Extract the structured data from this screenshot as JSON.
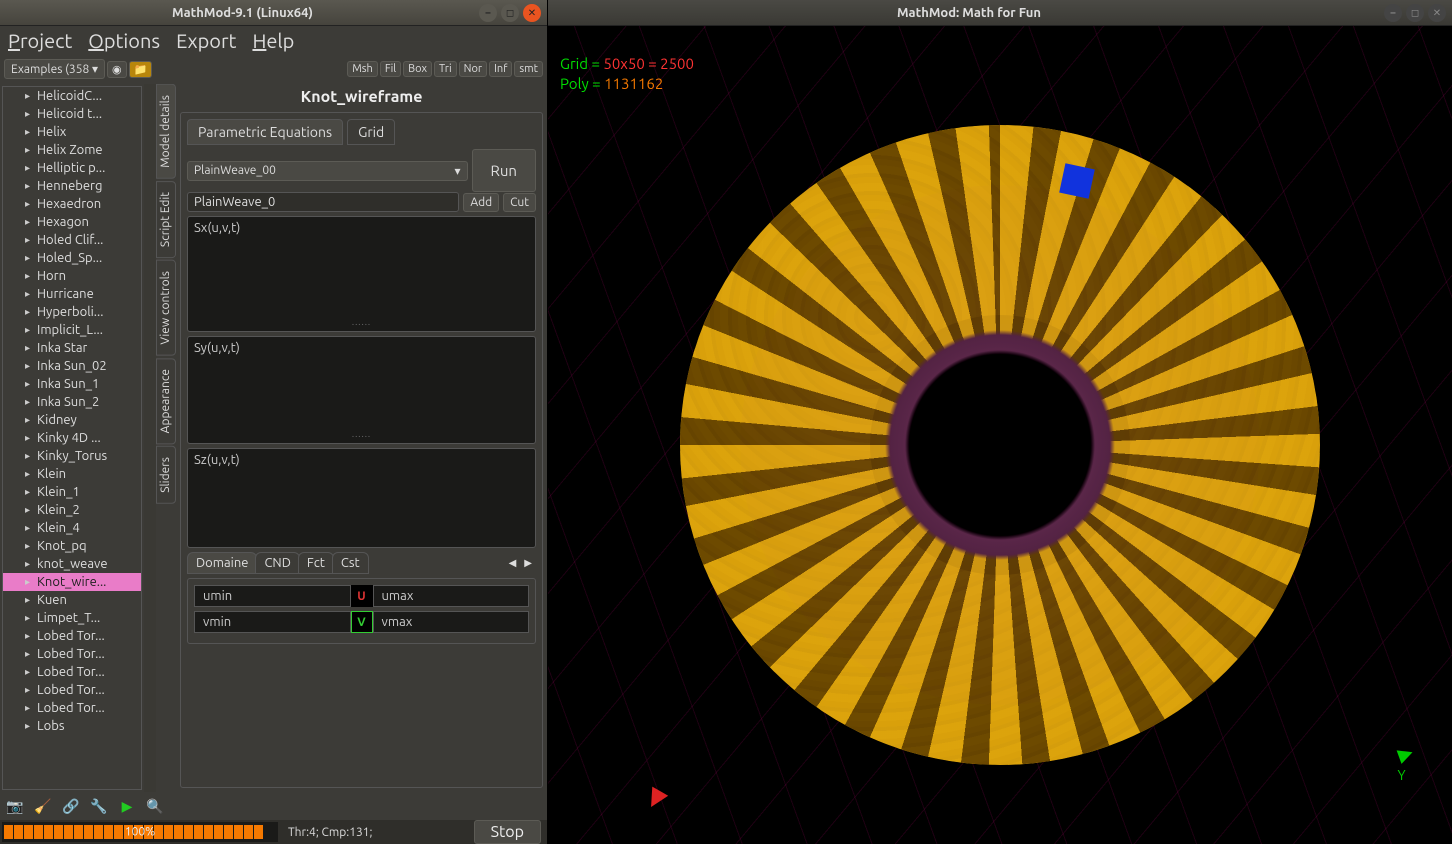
{
  "left_window": {
    "title": "MathMod-9.1 (Linux64)",
    "menubar": [
      "Project",
      "Options",
      "Export",
      "Help"
    ],
    "examples_btn": "Examples (358",
    "display_btns": [
      "Msh",
      "Fil",
      "Box",
      "Tri",
      "Nor",
      "Inf",
      "smt"
    ],
    "model_title": "Knot_wireframe",
    "tabs_main": [
      "Parametric Equations",
      "Grid"
    ],
    "dropdown_selected": "PlainWeave_00",
    "name_field": "PlainWeave_0",
    "add_btn": "Add",
    "cut_btn": "Cut",
    "run_btn": "Run",
    "eq_labels": {
      "sx": "Sx(u,v,t)",
      "sy": "Sy(u,v,t)",
      "sz": "Sz(u,v,t)"
    },
    "domain_tabs": [
      "Domaine",
      "CND",
      "Fct",
      "Cst"
    ],
    "domain_cells": {
      "umin": "umin",
      "umax": "umax",
      "vmin": "vmin",
      "vmax": "vmax",
      "u": "U",
      "v": "V"
    },
    "side_tabs": [
      "Model details",
      "Script Edit",
      "View controls",
      "Appearance",
      "Sliders"
    ],
    "tree_items": [
      "HelicoidC...",
      "Helicoid t...",
      "Helix",
      "Helix Zome",
      "Helliptic p...",
      "Henneberg",
      "Hexaedron",
      "Hexagon",
      "Holed Clif...",
      "Holed_Sp...",
      "Horn",
      "Hurricane",
      "Hyperboli...",
      "Implicit_L...",
      "Inka Star",
      "Inka Sun_02",
      "Inka Sun_1",
      "Inka Sun_2",
      "Kidney",
      "Kinky 4D ...",
      "Kinky_Torus",
      "Klein",
      "Klein_1",
      "Klein_2",
      "Klein_4",
      "Knot_pq",
      "knot_weave",
      "Knot_wire...",
      "Kuen",
      "Limpet_T...",
      "Lobed Tor...",
      "Lobed Tor...",
      "Lobed Tor...",
      "Lobed Tor...",
      "Lobed Tor...",
      "Lobs"
    ],
    "tree_selected_index": 27,
    "status": {
      "progress_pct": "100%",
      "thr": "Thr:4; Cmp:131;",
      "stop": "Stop"
    }
  },
  "right_window": {
    "title": "MathMod: Math for Fun",
    "overlay": {
      "grid_label": "Grid = ",
      "grid_val": "50x50 = 2500",
      "poly_label": "Poly = ",
      "poly_val": "1131162"
    },
    "y_axis": "Y"
  }
}
